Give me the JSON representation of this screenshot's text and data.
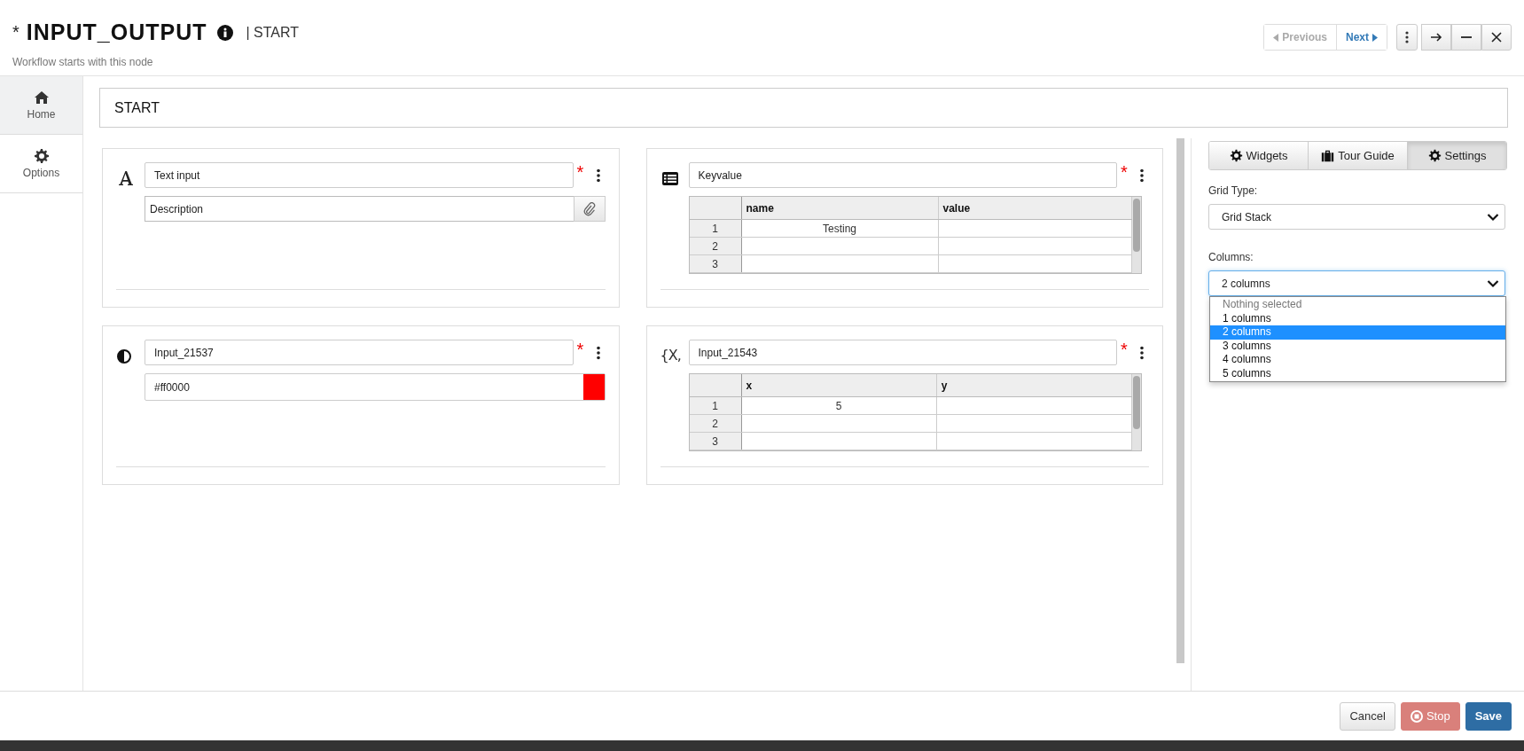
{
  "header": {
    "modified_mark": "*",
    "title": "INPUT_OUTPUT",
    "node": "| START",
    "subtitle": "Workflow starts with this node"
  },
  "nav": [
    {
      "label": "Previous",
      "kind": "previous",
      "disabled": true
    },
    {
      "label": "Next",
      "kind": "next",
      "disabled": false
    }
  ],
  "sidebar": {
    "items": [
      {
        "label": "Home",
        "kind": "home",
        "selected": true
      },
      {
        "label": "Options",
        "kind": "options",
        "selected": false
      }
    ]
  },
  "node_name": "START",
  "widgets": [
    {
      "kind": "text",
      "label": "Text input",
      "required": true,
      "description_placeholder": "Description"
    },
    {
      "kind": "keyvalue",
      "label": "Keyvalue",
      "required": true,
      "table": {
        "columns": [
          "name",
          "value"
        ],
        "rows": [
          {
            "index": "1",
            "cells": [
              "Testing"
            ]
          },
          {
            "index": "2"
          },
          {
            "index": "3"
          }
        ]
      }
    },
    {
      "kind": "color",
      "label": "Input_21537",
      "required": true,
      "value": "#ff0000"
    },
    {
      "kind": "xy",
      "icon_text": "{X,",
      "label": "Input_21543",
      "required": true,
      "table": {
        "columns": [
          "x",
          "y"
        ],
        "rows": [
          {
            "index": "1",
            "cells": [
              "5"
            ]
          },
          {
            "index": "2"
          },
          {
            "index": "3"
          }
        ]
      }
    }
  ],
  "panel_tabs": [
    {
      "label": "Widgets",
      "kind": "gear",
      "selected": false
    },
    {
      "label": "Tour Guide",
      "kind": "suitcase",
      "selected": false
    },
    {
      "label": "Settings",
      "kind": "gear",
      "selected": true
    }
  ],
  "settings": {
    "grid_type": {
      "label": "Grid Type:",
      "value": "Grid Stack"
    },
    "columns": {
      "label": "Columns:",
      "value": "2 columns",
      "expanded": true,
      "options": [
        {
          "label": "Nothing selected",
          "kind": "placeholder",
          "selected": false
        },
        {
          "label": "1 columns",
          "kind": "option",
          "selected": false
        },
        {
          "label": "2 columns",
          "kind": "option",
          "selected": true
        },
        {
          "label": "3 columns",
          "kind": "option",
          "selected": false
        },
        {
          "label": "4 columns",
          "kind": "option",
          "selected": false
        },
        {
          "label": "5 columns",
          "kind": "option",
          "selected": false
        }
      ]
    }
  },
  "footer_buttons": [
    {
      "label": "Cancel",
      "kind": "default"
    },
    {
      "label": "Stop",
      "kind": "danger"
    },
    {
      "label": "Save",
      "kind": "primary"
    }
  ]
}
